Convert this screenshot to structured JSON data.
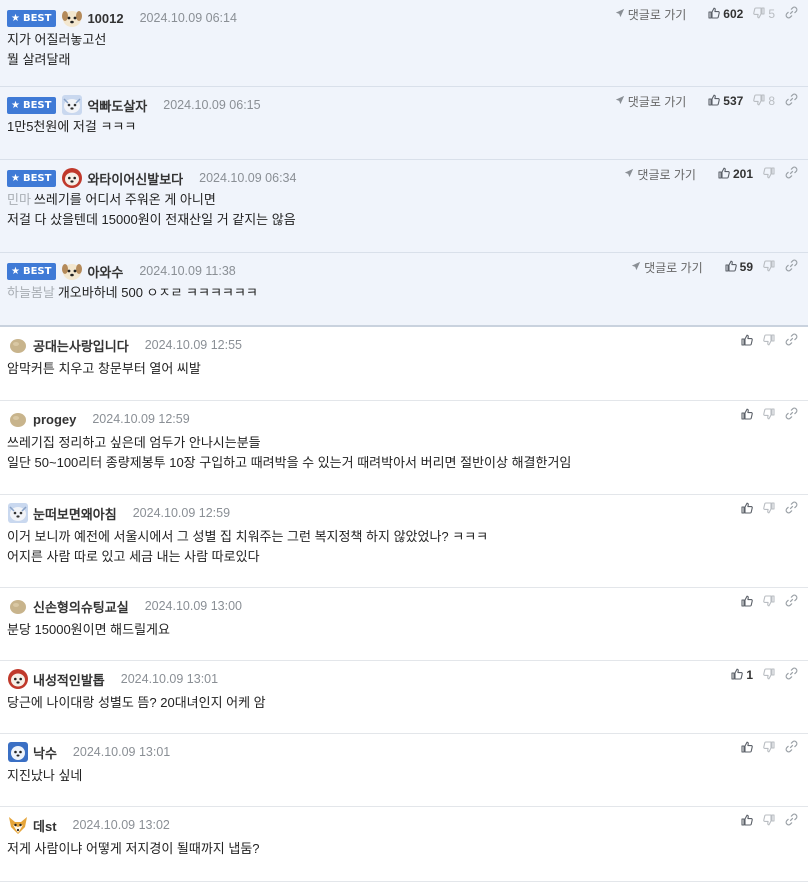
{
  "labels": {
    "best": "BEST",
    "goto_reply": "댓글로 가기"
  },
  "comments": [
    {
      "best": true,
      "nick": "10012",
      "date": "2024.10.09 06:14",
      "lines": [
        "지가 어질러놓고선",
        "뭘 살려달래"
      ],
      "reply_to": "",
      "likes": "602",
      "dislikes": "5",
      "avatar": "puppy-icon"
    },
    {
      "best": true,
      "nick": "억빠도살자",
      "date": "2024.10.09 06:15",
      "lines": [
        "1만5천원에 저걸 ㅋㅋㅋ"
      ],
      "reply_to": "",
      "likes": "537",
      "dislikes": "8",
      "avatar": "snow-dog-icon"
    },
    {
      "best": true,
      "nick": "와타이어신발보다",
      "date": "2024.10.09 06:34",
      "lines": [
        "쓰레기를 어디서 주워온 게 아니면",
        "저걸 다 샀을텐데 15000원이 전재산일 거 같지는 않음"
      ],
      "reply_to": "민마",
      "likes": "201",
      "dislikes": "",
      "avatar": "red-dog-icon"
    },
    {
      "best": true,
      "nick": "아와수",
      "date": "2024.10.09 11:38",
      "lines": [
        "개오바하네 500 ㅇㅈㄹ ㅋㅋㅋㅋㅋㅋ"
      ],
      "reply_to": "하늘봄날",
      "likes": "59",
      "dislikes": "",
      "avatar": "puppy-icon"
    },
    {
      "best": false,
      "nick": "공대는사랑입니다",
      "date": "2024.10.09 12:55",
      "lines": [
        "암막커튼 치우고 창문부터 열어 씨발"
      ],
      "reply_to": "",
      "likes": "",
      "dislikes": "",
      "avatar": "potato-icon"
    },
    {
      "best": false,
      "nick": "progey",
      "date": "2024.10.09 12:59",
      "lines": [
        "쓰레기집 정리하고 싶은데 엄두가 안나시는분들",
        "일단 50~100리터 종량제봉투 10장 구입하고 때려박을 수 있는거 때려박아서 버리면 절반이상 해결한거임"
      ],
      "reply_to": "",
      "likes": "",
      "dislikes": "",
      "avatar": "potato-icon"
    },
    {
      "best": false,
      "nick": "눈떠보면왜아침",
      "date": "2024.10.09 12:59",
      "lines": [
        "이거 보니까 예전에 서울시에서 그 성별 집 치워주는 그런 복지정책 하지 않았었나? ㅋㅋㅋ",
        "어지른 사람 따로 있고 세금 내는 사람 따로있다"
      ],
      "reply_to": "",
      "likes": "",
      "dislikes": "",
      "avatar": "snow-dog-icon"
    },
    {
      "best": false,
      "nick": "신손형의슈팅교실",
      "date": "2024.10.09 13:00",
      "lines": [
        "분당 15000원이면 해드릴게요"
      ],
      "reply_to": "",
      "likes": "",
      "dislikes": "",
      "avatar": "potato-icon"
    },
    {
      "best": false,
      "nick": "내성적인발톱",
      "date": "2024.10.09 13:01",
      "lines": [
        "당근에 나이대랑 성별도 뜸? 20대녀인지 어케 암"
      ],
      "reply_to": "",
      "likes": "1",
      "dislikes": "",
      "avatar": "red-dog-icon"
    },
    {
      "best": false,
      "nick": "낙수",
      "date": "2024.10.09 13:01",
      "lines": [
        "지진났나 싶네"
      ],
      "reply_to": "",
      "likes": "",
      "dislikes": "",
      "avatar": "blue-dog-icon"
    },
    {
      "best": false,
      "nick": "데st",
      "date": "2024.10.09 13:02",
      "lines": [
        "저게 사람이냐 어떻게 저지경이 될때까지 냅둠?"
      ],
      "reply_to": "",
      "likes": "",
      "dislikes": "",
      "avatar": "fox-icon"
    }
  ]
}
